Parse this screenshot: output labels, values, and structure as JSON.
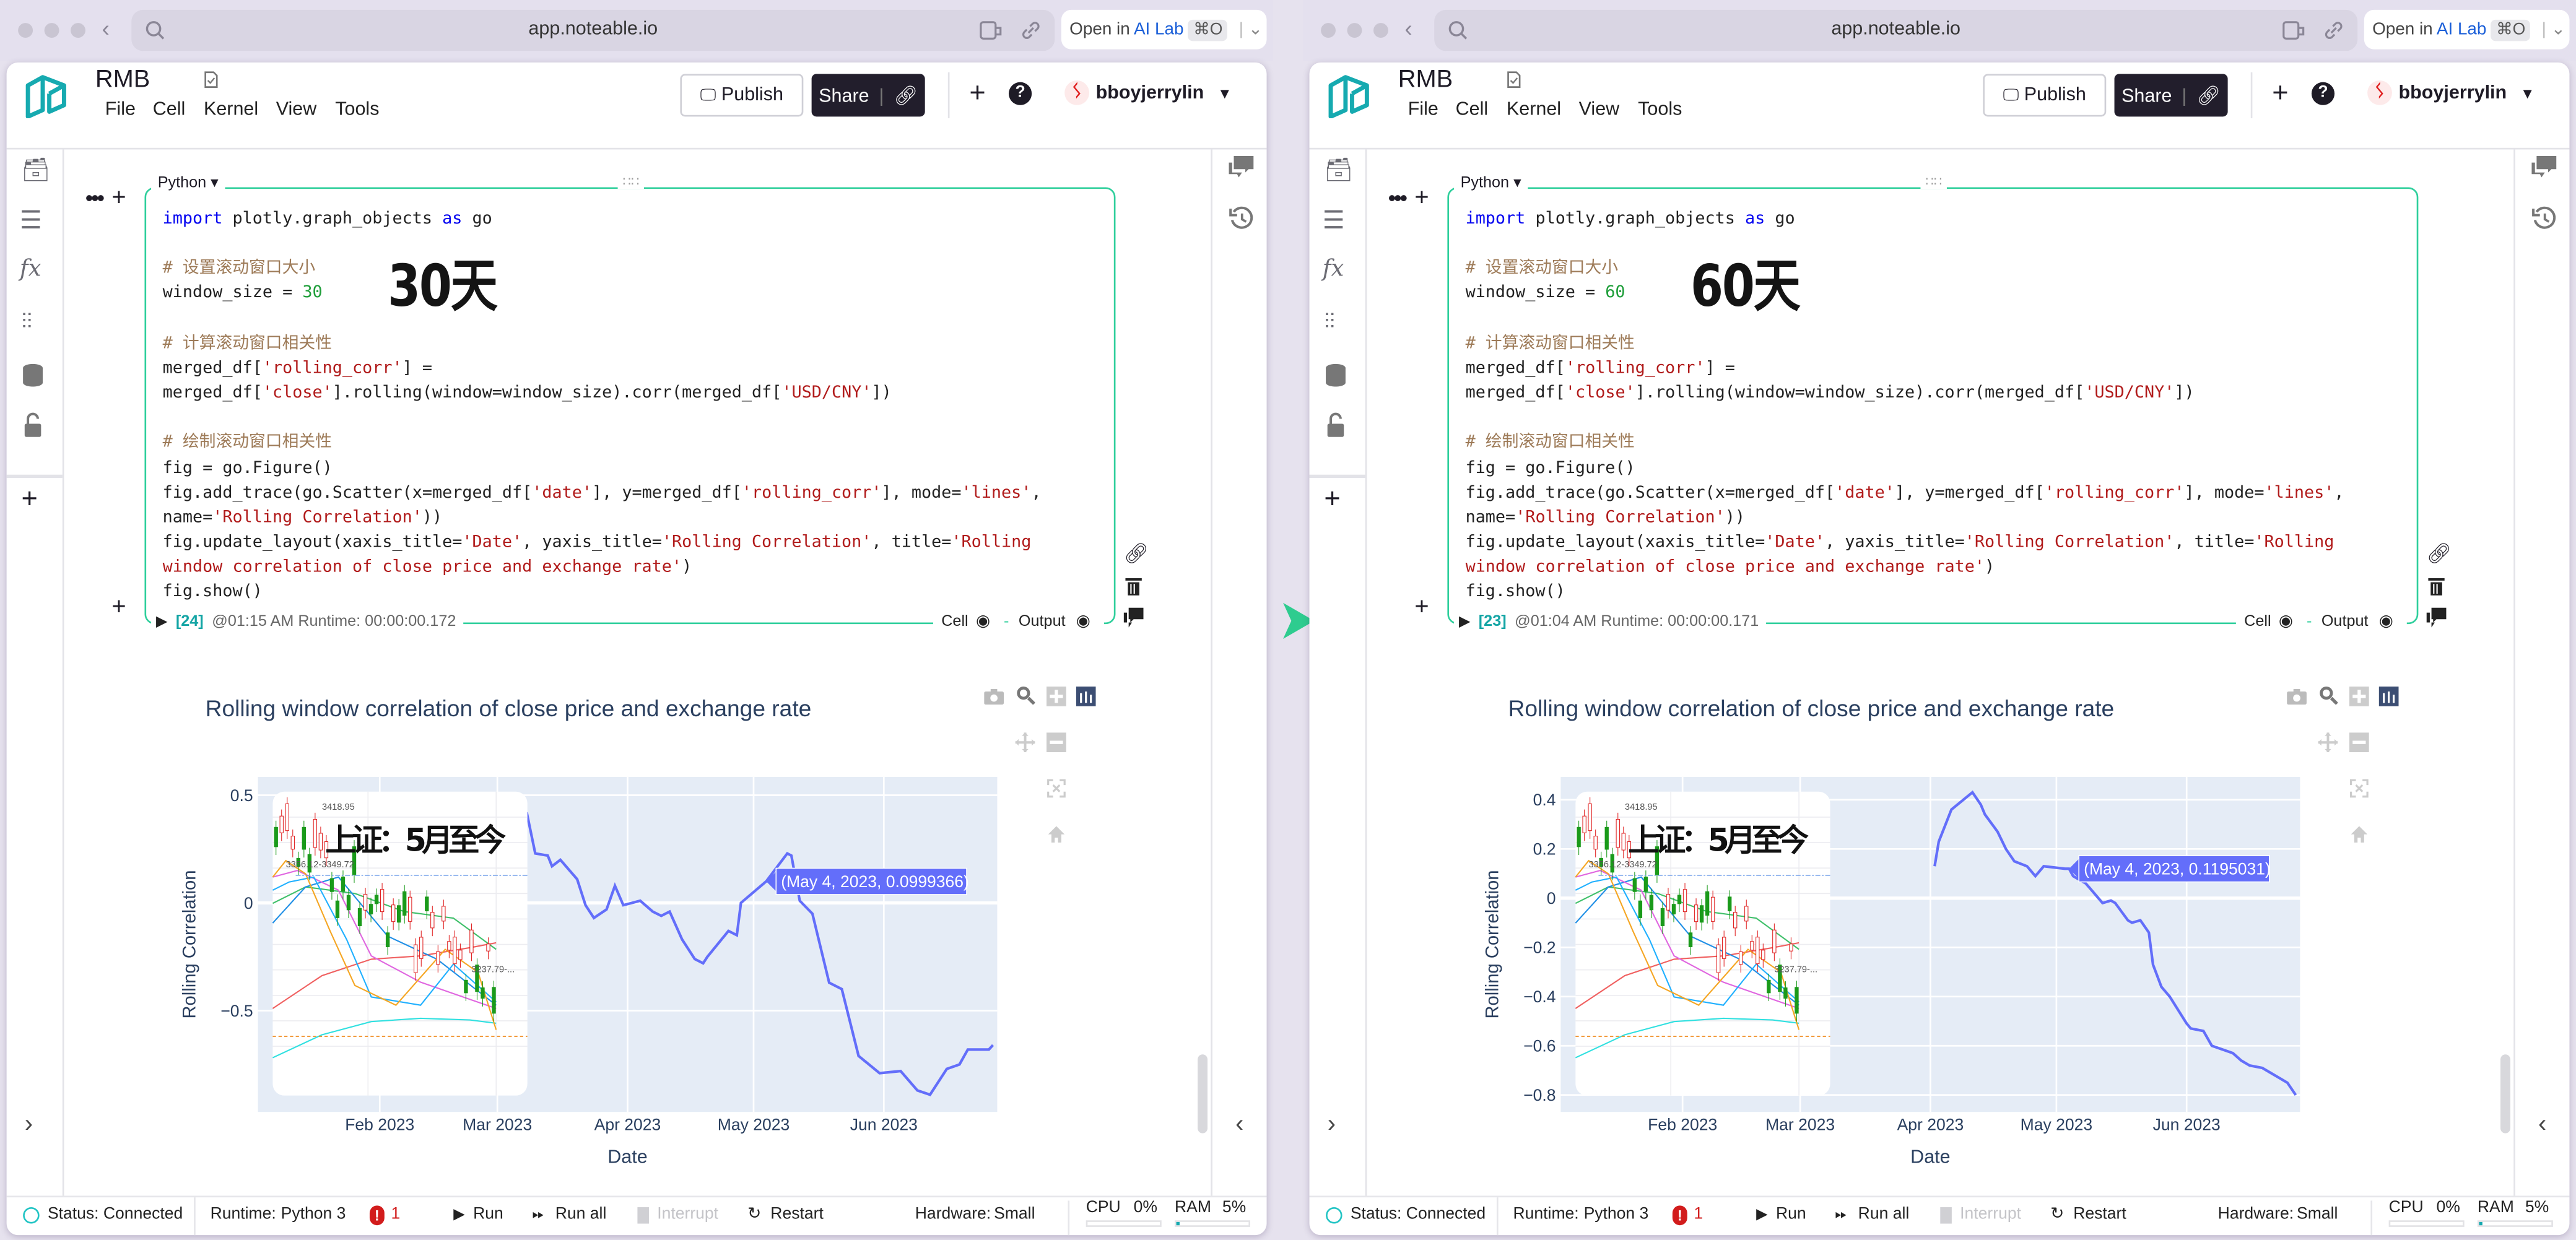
{
  "transition_arrow_color": "#2ecc8f",
  "panels": [
    {
      "browser": {
        "url": "app.noteable.io",
        "open_in": "Open in",
        "ai_lab": "AI Lab",
        "shortcut": "⌘O"
      },
      "header": {
        "title": "RMB",
        "menu": [
          "File",
          "Cell",
          "Kernel",
          "View",
          "Tools"
        ],
        "publish": "Publish",
        "share": "Share",
        "user": "bboyjerrylin"
      },
      "cell": {
        "language": "Python ▾",
        "annotation": "30天",
        "exec_count": "[24]",
        "run_info": "@01:15 AM Runtime: 00:00:00.172",
        "cell_label": "Cell",
        "output_label": "Output",
        "code": [
          [
            {
              "t": "kw",
              "v": "import"
            },
            {
              "t": "p",
              "v": " plotly.graph_objects "
            },
            {
              "t": "kw",
              "v": "as"
            },
            {
              "t": "p",
              "v": " go"
            }
          ],
          [],
          [
            {
              "t": "cmt",
              "v": "# 设置滚动窗口大小"
            }
          ],
          [
            {
              "t": "p",
              "v": "window_size = "
            },
            {
              "t": "num",
              "v": "30"
            }
          ],
          [],
          [
            {
              "t": "cmt",
              "v": "# 计算滚动窗口相关性"
            }
          ],
          [
            {
              "t": "p",
              "v": "merged_df["
            },
            {
              "t": "str",
              "v": "'rolling_corr'"
            },
            {
              "t": "p",
              "v": "] ="
            }
          ],
          [
            {
              "t": "p",
              "v": "merged_df["
            },
            {
              "t": "str",
              "v": "'close'"
            },
            {
              "t": "p",
              "v": "].rolling(window=window_size).corr(merged_df["
            },
            {
              "t": "str",
              "v": "'USD/CNY'"
            },
            {
              "t": "p",
              "v": "])"
            }
          ],
          [],
          [
            {
              "t": "cmt",
              "v": "# 绘制滚动窗口相关性"
            }
          ],
          [
            {
              "t": "p",
              "v": "fig = go.Figure()"
            }
          ],
          [
            {
              "t": "p",
              "v": "fig.add_trace(go.Scatter(x=merged_df["
            },
            {
              "t": "str",
              "v": "'date'"
            },
            {
              "t": "p",
              "v": "], y=merged_df["
            },
            {
              "t": "str",
              "v": "'rolling_corr'"
            },
            {
              "t": "p",
              "v": "], mode="
            },
            {
              "t": "str",
              "v": "'lines'"
            },
            {
              "t": "p",
              "v": ","
            }
          ],
          [
            {
              "t": "p",
              "v": "name="
            },
            {
              "t": "str",
              "v": "'Rolling Correlation'"
            },
            {
              "t": "p",
              "v": "))"
            }
          ],
          [
            {
              "t": "p",
              "v": "fig.update_layout(xaxis_title="
            },
            {
              "t": "str",
              "v": "'Date'"
            },
            {
              "t": "p",
              "v": ", yaxis_title="
            },
            {
              "t": "str",
              "v": "'Rolling Correlation'"
            },
            {
              "t": "p",
              "v": ", title="
            },
            {
              "t": "str",
              "v": "'Rolling"
            }
          ],
          [
            {
              "t": "str",
              "v": "window correlation of close price and exchange rate'"
            },
            {
              "t": "p",
              "v": ")"
            }
          ],
          [
            {
              "t": "p",
              "v": "fig.show()"
            }
          ]
        ]
      },
      "inset": {
        "title": "上证：5月至今",
        "high": "3418.95",
        "range": "3356.12-3349.72",
        "low": "3237.79-..."
      },
      "status": {
        "status": "Status: Connected",
        "runtime_label": "Runtime:",
        "runtime": "Python 3",
        "errors": "1",
        "run": "Run",
        "run_all": "Run all",
        "interrupt": "Interrupt",
        "restart": "Restart",
        "hardware_label": "Hardware:",
        "hardware": "Small",
        "cpu_label": "CPU",
        "cpu": "0%",
        "ram_label": "RAM",
        "ram": "5%",
        "cpu_fraction": 0.0,
        "ram_fraction": 0.05
      }
    },
    {
      "browser": {
        "url": "app.noteable.io",
        "open_in": "Open in",
        "ai_lab": "AI Lab",
        "shortcut": "⌘O"
      },
      "header": {
        "title": "RMB",
        "menu": [
          "File",
          "Cell",
          "Kernel",
          "View",
          "Tools"
        ],
        "publish": "Publish",
        "share": "Share",
        "user": "bboyjerrylin"
      },
      "cell": {
        "language": "Python ▾",
        "annotation": "60天",
        "exec_count": "[23]",
        "run_info": "@01:04 AM Runtime: 00:00:00.171",
        "cell_label": "Cell",
        "output_label": "Output",
        "code": [
          [
            {
              "t": "kw",
              "v": "import"
            },
            {
              "t": "p",
              "v": " plotly.graph_objects "
            },
            {
              "t": "kw",
              "v": "as"
            },
            {
              "t": "p",
              "v": " go"
            }
          ],
          [],
          [
            {
              "t": "cmt",
              "v": "# 设置滚动窗口大小"
            }
          ],
          [
            {
              "t": "p",
              "v": "window_size = "
            },
            {
              "t": "num",
              "v": "60"
            }
          ],
          [],
          [
            {
              "t": "cmt",
              "v": "# 计算滚动窗口相关性"
            }
          ],
          [
            {
              "t": "p",
              "v": "merged_df["
            },
            {
              "t": "str",
              "v": "'rolling_corr'"
            },
            {
              "t": "p",
              "v": "] ="
            }
          ],
          [
            {
              "t": "p",
              "v": "merged_df["
            },
            {
              "t": "str",
              "v": "'close'"
            },
            {
              "t": "p",
              "v": "].rolling(window=window_size).corr(merged_df["
            },
            {
              "t": "str",
              "v": "'USD/CNY'"
            },
            {
              "t": "p",
              "v": "])"
            }
          ],
          [],
          [
            {
              "t": "cmt",
              "v": "# 绘制滚动窗口相关性"
            }
          ],
          [
            {
              "t": "p",
              "v": "fig = go.Figure()"
            }
          ],
          [
            {
              "t": "p",
              "v": "fig.add_trace(go.Scatter(x=merged_df["
            },
            {
              "t": "str",
              "v": "'date'"
            },
            {
              "t": "p",
              "v": "], y=merged_df["
            },
            {
              "t": "str",
              "v": "'rolling_corr'"
            },
            {
              "t": "p",
              "v": "], mode="
            },
            {
              "t": "str",
              "v": "'lines'"
            },
            {
              "t": "p",
              "v": ","
            }
          ],
          [
            {
              "t": "p",
              "v": "name="
            },
            {
              "t": "str",
              "v": "'Rolling Correlation'"
            },
            {
              "t": "p",
              "v": "))"
            }
          ],
          [
            {
              "t": "p",
              "v": "fig.update_layout(xaxis_title="
            },
            {
              "t": "str",
              "v": "'Date'"
            },
            {
              "t": "p",
              "v": ", yaxis_title="
            },
            {
              "t": "str",
              "v": "'Rolling Correlation'"
            },
            {
              "t": "p",
              "v": ", title="
            },
            {
              "t": "str",
              "v": "'Rolling"
            }
          ],
          [
            {
              "t": "str",
              "v": "window correlation of close price and exchange rate'"
            },
            {
              "t": "p",
              "v": ")"
            }
          ],
          [
            {
              "t": "p",
              "v": "fig.show()"
            }
          ]
        ]
      },
      "inset": {
        "title": "上证：5月至今",
        "high": "3418.95",
        "range": "3356.12-3349.72",
        "low": "3237.79-..."
      },
      "status": {
        "status": "Status: Connected",
        "runtime_label": "Runtime:",
        "runtime": "Python 3",
        "errors": "1",
        "run": "Run",
        "run_all": "Run all",
        "interrupt": "Interrupt",
        "restart": "Restart",
        "hardware_label": "Hardware:",
        "hardware": "Small",
        "cpu_label": "CPU",
        "cpu": "0%",
        "ram_label": "RAM",
        "ram": "5%",
        "cpu_fraction": 0.0,
        "ram_fraction": 0.05
      }
    }
  ],
  "chart_data": [
    {
      "type": "line",
      "title": "Rolling window correlation of close price and exchange rate",
      "xlabel": "Date",
      "ylabel": "Rolling Correlation",
      "series_name": "Rolling Correlation",
      "color": "#636efa",
      "xlim": [
        "2023-01-03",
        "2023-06-28"
      ],
      "ylim": [
        -0.97,
        0.585
      ],
      "x_ticks": [
        {
          "date": "2023-02-01",
          "label": "Feb 2023"
        },
        {
          "date": "2023-03-01",
          "label": "Mar 2023"
        },
        {
          "date": "2023-04-01",
          "label": "Apr 2023"
        },
        {
          "date": "2023-05-01",
          "label": "May 2023"
        },
        {
          "date": "2023-06-01",
          "label": "Jun 2023"
        }
      ],
      "y_ticks": [
        {
          "value": 0.5,
          "label": "0.5"
        },
        {
          "value": 0,
          "label": "0"
        },
        {
          "value": -0.5,
          "label": "−0.5"
        }
      ],
      "grid": true,
      "x": [
        "2023-03-08",
        "2023-03-10",
        "2023-03-13",
        "2023-03-14",
        "2023-03-16",
        "2023-03-20",
        "2023-03-22",
        "2023-03-24",
        "2023-03-27",
        "2023-03-29",
        "2023-03-31",
        "2023-04-04",
        "2023-04-07",
        "2023-04-09",
        "2023-04-11",
        "2023-04-14",
        "2023-04-17",
        "2023-04-19",
        "2023-04-20",
        "2023-04-25",
        "2023-04-27",
        "2023-04-28",
        "2023-05-04",
        "2023-05-09",
        "2023-05-10",
        "2023-05-12",
        "2023-05-15",
        "2023-05-19",
        "2023-05-22",
        "2023-05-26",
        "2023-05-31",
        "2023-06-05",
        "2023-06-09",
        "2023-06-12",
        "2023-06-16",
        "2023-06-19",
        "2023-06-21",
        "2023-06-26",
        "2023-06-27"
      ],
      "y": [
        0.42,
        0.23,
        0.22,
        0.17,
        0.2,
        0.11,
        -0.01,
        -0.07,
        -0.03,
        0.08,
        -0.01,
        0.01,
        -0.04,
        -0.06,
        -0.04,
        -0.17,
        -0.26,
        -0.28,
        -0.25,
        -0.13,
        -0.15,
        0.0,
        0.0999,
        0.23,
        0.22,
        0.01,
        -0.05,
        -0.37,
        -0.4,
        -0.71,
        -0.79,
        -0.78,
        -0.87,
        -0.89,
        -0.77,
        -0.75,
        -0.68,
        -0.68,
        -0.66
      ],
      "hover": {
        "date": "2023-05-04",
        "value": 0.0999366,
        "label": "(May 4, 2023, 0.0999366)"
      }
    },
    {
      "type": "line",
      "title": "Rolling window correlation of close price and exchange rate",
      "xlabel": "Date",
      "ylabel": "Rolling Correlation",
      "series_name": "Rolling Correlation",
      "color": "#636efa",
      "xlim": [
        "2023-01-03",
        "2023-06-28"
      ],
      "ylim": [
        -0.869,
        0.493
      ],
      "x_ticks": [
        {
          "date": "2023-02-01",
          "label": "Feb 2023"
        },
        {
          "date": "2023-03-01",
          "label": "Mar 2023"
        },
        {
          "date": "2023-04-01",
          "label": "Apr 2023"
        },
        {
          "date": "2023-05-01",
          "label": "May 2023"
        },
        {
          "date": "2023-06-01",
          "label": "Jun 2023"
        }
      ],
      "y_ticks": [
        {
          "value": 0.4,
          "label": "0.4"
        },
        {
          "value": 0.2,
          "label": "0.2"
        },
        {
          "value": 0,
          "label": "0"
        },
        {
          "value": -0.2,
          "label": "−0.2"
        },
        {
          "value": -0.4,
          "label": "−0.4"
        },
        {
          "value": -0.6,
          "label": "−0.6"
        },
        {
          "value": -0.8,
          "label": "−0.8"
        }
      ],
      "grid": true,
      "x": [
        "2023-04-02",
        "2023-04-03",
        "2023-04-06",
        "2023-04-11",
        "2023-04-13",
        "2023-04-14",
        "2023-04-17",
        "2023-04-19",
        "2023-04-21",
        "2023-04-24",
        "2023-04-26",
        "2023-04-28",
        "2023-05-03",
        "2023-05-04",
        "2023-05-05",
        "2023-05-08",
        "2023-05-09",
        "2023-05-12",
        "2023-05-14",
        "2023-05-15",
        "2023-05-18",
        "2023-05-19",
        "2023-05-21",
        "2023-05-23",
        "2023-05-24",
        "2023-05-26",
        "2023-05-28",
        "2023-06-01",
        "2023-06-02",
        "2023-06-05",
        "2023-06-07",
        "2023-06-12",
        "2023-06-14",
        "2023-06-16",
        "2023-06-19",
        "2023-06-21",
        "2023-06-25",
        "2023-06-27"
      ],
      "y": [
        0.13,
        0.23,
        0.36,
        0.43,
        0.38,
        0.34,
        0.27,
        0.2,
        0.15,
        0.13,
        0.09,
        0.13,
        0.12,
        0.1195,
        0.09,
        0.06,
        0.04,
        -0.02,
        -0.01,
        -0.02,
        -0.09,
        -0.1,
        -0.09,
        -0.14,
        -0.27,
        -0.36,
        -0.4,
        -0.51,
        -0.53,
        -0.54,
        -0.6,
        -0.63,
        -0.66,
        -0.68,
        -0.69,
        -0.71,
        -0.75,
        -0.8
      ],
      "hover": {
        "date": "2023-05-04",
        "value": 0.1195031,
        "label": "(May 4, 2023, 0.1195031)"
      }
    }
  ]
}
